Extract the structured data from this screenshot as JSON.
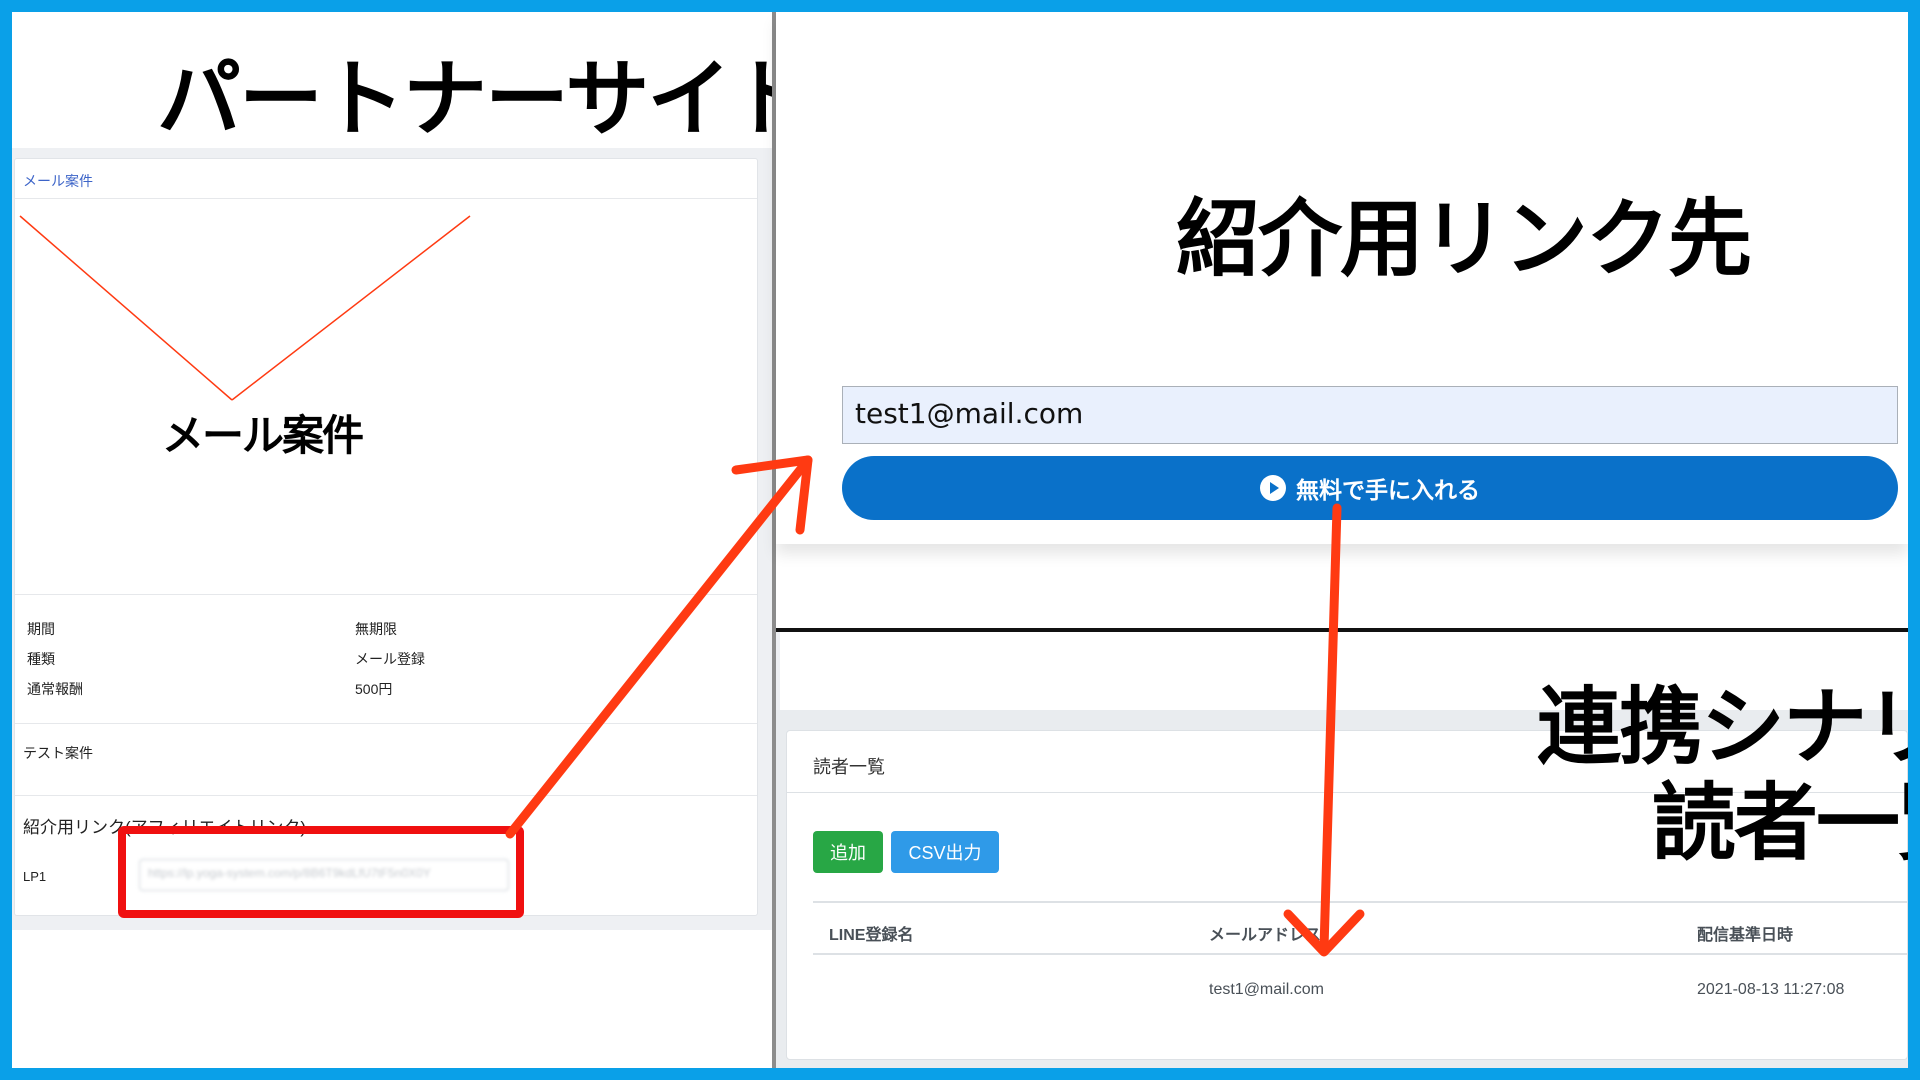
{
  "left_panel": {
    "title": "パートナーサイト",
    "card_header": "メール案件",
    "diagram_label": "メール案件",
    "details": [
      {
        "label": "期間",
        "value": "無期限"
      },
      {
        "label": "種類",
        "value": "メール登録"
      },
      {
        "label": "通常報酬",
        "value": "500円"
      }
    ],
    "description": "テスト案件",
    "affiliate_title": "紹介用リンク(アフィリエイトリンク)",
    "lp_label": "LP1",
    "lp_value": "https://lp.yoga-system.com/p/8B6T9kdLfU7tF5n0X0Y"
  },
  "right_top": {
    "title": "紹介用リンク先",
    "email_value": "test1@mail.com",
    "cta_label": "無料で手に入れる",
    "cta_icon": "play-circle-icon"
  },
  "right_bottom": {
    "title_line1": "連携シナリオ",
    "title_line2": "読者一覧",
    "card_header": "読者一覧",
    "add_button": "追加",
    "csv_button": "CSV出力",
    "columns": [
      "LINE登録名",
      "メールアドレス",
      "配信基準日時"
    ],
    "rows": [
      {
        "line_name": "",
        "email": "test1@mail.com",
        "datetime": "2021-08-13 11:27:08"
      }
    ]
  },
  "colors": {
    "border": "#0aa0e8",
    "arrow": "#ff3a12",
    "highlight_box": "#f01010",
    "cta": "#0a71c9",
    "add": "#28a745",
    "csv": "#2f9ae8"
  }
}
